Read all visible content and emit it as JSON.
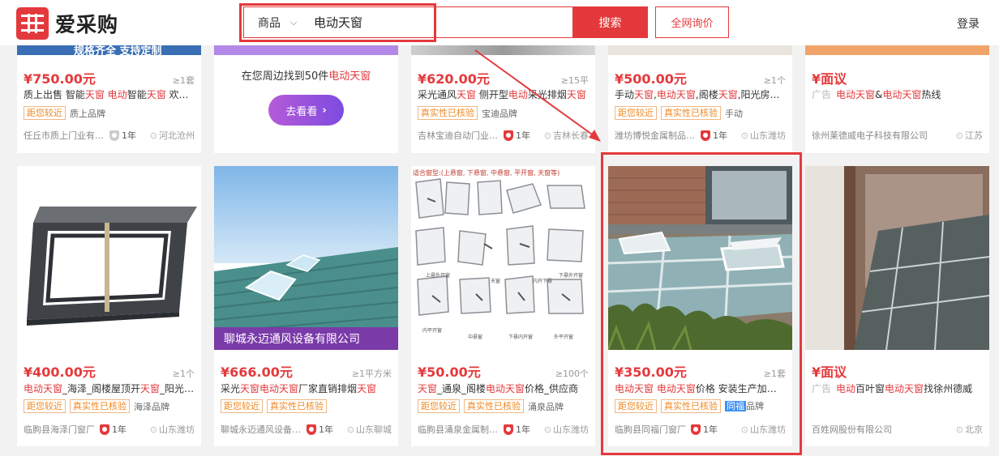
{
  "logo": {
    "text": "爱采购"
  },
  "search": {
    "category": "商品",
    "query": "电动天窗",
    "button": "搜索",
    "inquiry": "全网询价"
  },
  "nav": {
    "login": "登录"
  },
  "row1": {
    "c1": {
      "banner": "规格齐全 支持定制",
      "price": "¥750.00元",
      "moq": "≥1套",
      "title": "质上出售 智能天窗 电动智能天窗 欢迎选购",
      "tags": [
        "距您较近"
      ],
      "brand": "质上品牌",
      "seller": "任丘市质上门业有限公司",
      "years": "1年",
      "location": "河北沧州"
    },
    "c2": {
      "nearby_prefix": "在您周边找到50件",
      "nearby_kw": "电动天窗",
      "go": "去看看"
    },
    "c3": {
      "price": "¥620.00元",
      "moq": "≥15平",
      "title": "采光通风天窗 侧开型电动采光排烟天窗",
      "tags": [
        "真实性已核验"
      ],
      "brand": "宝迪品牌",
      "seller": "吉林宝迪自动门业有限公司",
      "years": "1年",
      "location": "吉林长春"
    },
    "c4": {
      "price": "¥500.00元",
      "moq": "≥1个",
      "title": "手动天窗,电动天窗,阁楼天窗,阳光房天窗",
      "tags": [
        "距您较近",
        "真实性已核验"
      ],
      "brand": "手动",
      "seller": "潍坊博悦金属制品有限公司",
      "years": "1年",
      "location": "山东潍坊"
    },
    "c5": {
      "price": "¥面议",
      "ad": "广告",
      "title": "电动天窗&电动天窗热线",
      "seller": "徐州莱德威电子科技有限公司",
      "location": "江苏"
    }
  },
  "row2": {
    "c1": {
      "price": "¥400.00元",
      "moq": "≥1个",
      "title": "电动天窗_海泽_阁楼屋顶开天窗_阳光房天窗",
      "tags": [
        "距您较近",
        "真实性已核验"
      ],
      "brand": "海泽品牌",
      "seller": "临朐县海泽门窗厂",
      "years": "1年",
      "location": "山东潍坊"
    },
    "c2": {
      "photo_text": "聊城永迈通风设备有限公司",
      "price": "¥666.00元",
      "moq": "≥1平方米",
      "title": "采光天窗电动天窗厂家直销排烟天窗",
      "tags": [
        "距您较近",
        "真实性已核验"
      ],
      "seller": "聊城永迈通风设备有限公司",
      "years": "1年",
      "location": "山东聊城"
    },
    "c3": {
      "photo_caption": "适合窗型:(上悬窗, 下悬窗, 中悬窗, 平开窗, 天窗等)",
      "labels": [
        "上悬外开窗",
        "天窗",
        "内开下悬",
        "下悬外开窗",
        "内平开窗",
        "中悬窗",
        "下悬内开窗",
        "外平开窗"
      ],
      "price": "¥50.00元",
      "moq": "≥100个",
      "title": "天窗_通泉_阁楼电动天窗价格_供应商",
      "tags": [
        "距您较近",
        "真实性已核验"
      ],
      "brand": "涌泉品牌",
      "seller": "临朐县涌泉金属制品厂",
      "years": "1年",
      "location": "山东潍坊"
    },
    "c4": {
      "price": "¥350.00元",
      "moq": "≥1套",
      "title": "电动天窗 电动天窗价格 安装生产加工厂家",
      "tags": [
        "距您较近",
        "真实性已核验"
      ],
      "brand_tag": "同福",
      "brand": "品牌",
      "seller": "临朐县同福门窗厂",
      "years": "1年",
      "location": "山东潍坊"
    },
    "c5": {
      "price": "¥面议",
      "ad": "广告",
      "title": "电动百叶窗电动天窗找徐州德威",
      "seller": "百姓网股份有限公司",
      "location": "北京"
    }
  },
  "colors": {
    "accent": "#e4393c",
    "tag": "#f08a24",
    "purple": "#8b4fe0"
  }
}
